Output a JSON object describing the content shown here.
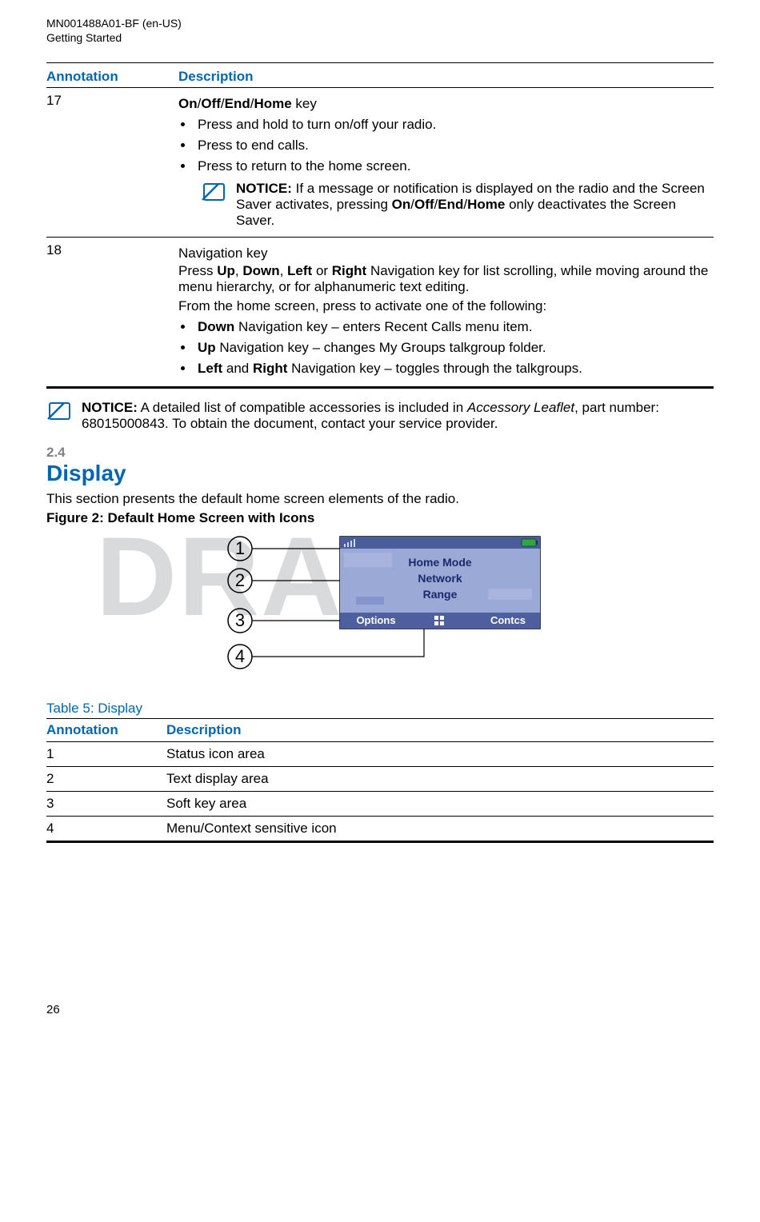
{
  "meta": {
    "doc_id": "MN001488A01-BF (en-US)",
    "section_path": "Getting Started",
    "page_number": "26",
    "watermark": "DRAFT"
  },
  "table1": {
    "header_annotation": "Annotation",
    "header_description": "Description",
    "row17": {
      "annotation": "17",
      "title_parts": {
        "on": "On",
        "off": "Off",
        "end": "End",
        "home": "Home",
        "suffix": " key"
      },
      "b1": "Press and hold to turn on/off your radio.",
      "b2": "Press to end calls.",
      "b3": "Press to return to the home screen.",
      "notice_label": "NOTICE:",
      "notice_pre": " If a message or notification is displayed on the radio and the Screen Saver activates, pressing ",
      "notice_post": " only deactivates the Screen Saver."
    },
    "row18": {
      "annotation": "18",
      "nav_title": "Navigation key",
      "nav_press": "Press ",
      "up": "Up",
      "down": "Down",
      "left": "Left",
      "right": "Right",
      "nav_rest": " Navigation key for list scrolling, while moving around the menu hierarchy, or for alphanumeric text editing.",
      "line2": "From the home screen, press to activate one of the following:",
      "li1_suffix": " Navigation key – enters Recent Calls menu item.",
      "li2_suffix": " Navigation key – changes My Groups talkgroup folder.",
      "li3_mid": " and ",
      "li3_suffix": " Navigation key – toggles through the talkgroups."
    }
  },
  "standalone_notice": {
    "label": "NOTICE:",
    "pre": " A detailed list of compatible accessories is included in ",
    "em": "Accessory Leaflet",
    "post": ", part number: 68015000843. To obtain the document, contact your service provider."
  },
  "section": {
    "num": "2.4",
    "title": "Display",
    "body": "This section presents the default home screen elements of the radio.",
    "fig_caption": "Figure 2: Default Home Screen with Icons"
  },
  "figure": {
    "callouts": {
      "c1": "1",
      "c2": "2",
      "c3": "3",
      "c4": "4"
    },
    "screen": {
      "line1": "Home Mode",
      "line2": "Network",
      "line3": "Range",
      "soft_left": "Options",
      "soft_right": "Contcs"
    }
  },
  "table5": {
    "caption": "Table 5: Display",
    "header_annotation": "Annotation",
    "header_description": "Description",
    "rows": [
      {
        "a": "1",
        "d": "Status icon area"
      },
      {
        "a": "2",
        "d": "Text display area"
      },
      {
        "a": "3",
        "d": "Soft key area"
      },
      {
        "a": "4",
        "d": "Menu/Context sensitive icon"
      }
    ]
  }
}
